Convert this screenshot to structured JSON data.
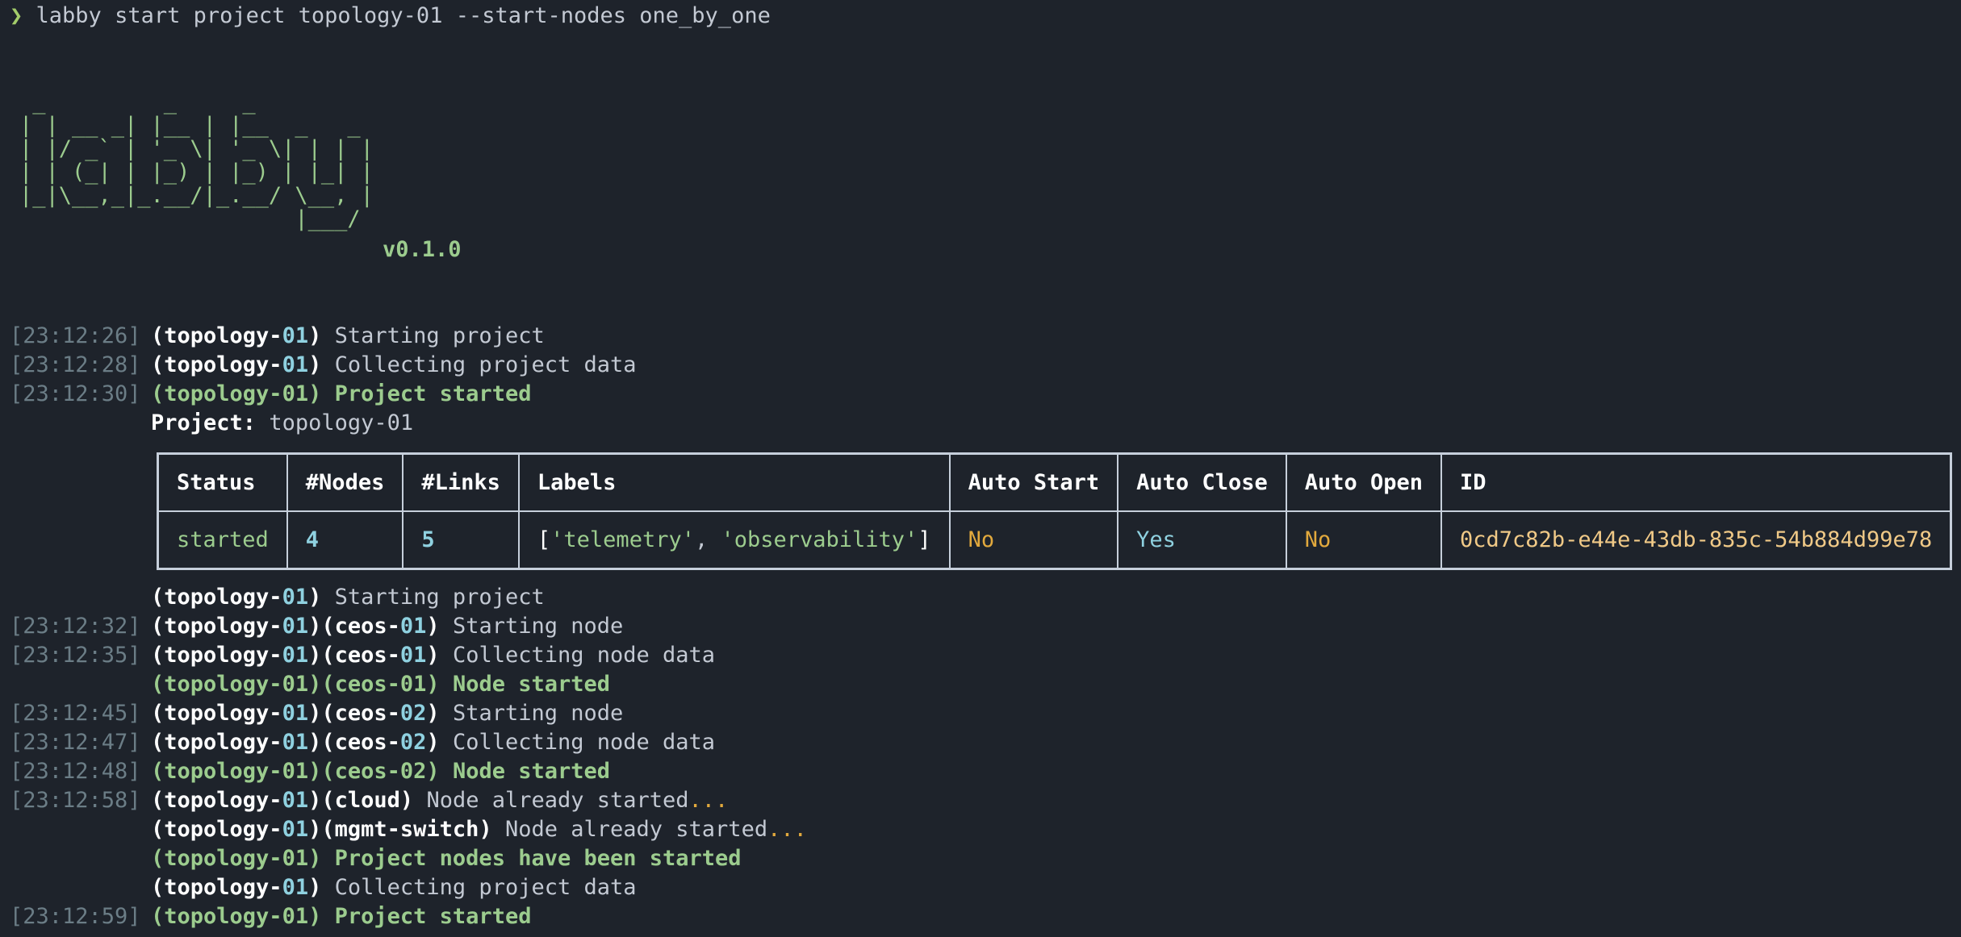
{
  "command": {
    "prompt_symbol": "❯",
    "text": "labby start project topology-01 --start-nodes one_by_one"
  },
  "banner": {
    "ascii": " _         _     _\n| | __ _| |__ | |__  _   _\n| |/ _` | '_ \\| '_ \\| | | |\n| | (_| | |_) | |_) | |_| |\n|_|\\__,_|_.__/|_.__/ \\__, |\n                     |___/",
    "version": "v0.1.0"
  },
  "log_top": [
    {
      "ts": "[23:12:26]",
      "project": "topology-",
      "project_num": "01",
      "msg": "Starting project",
      "success": false
    },
    {
      "ts": "[23:12:28]",
      "project": "topology-",
      "project_num": "01",
      "msg": "Collecting project data",
      "success": false
    },
    {
      "ts": "[23:12:30]",
      "project": "topology-",
      "project_num": "01",
      "msg": "Project started",
      "success": true
    }
  ],
  "project_label": "Project:",
  "project_name": "topology-01",
  "table": {
    "headers": [
      "Status",
      "#Nodes",
      "#Links",
      "Labels",
      "Auto Start",
      "Auto Close",
      "Auto Open",
      "ID"
    ],
    "row": {
      "status": "started",
      "nodes": "4",
      "links": "5",
      "label_open": "[",
      "label_1": "'telemetry'",
      "label_sep": ", ",
      "label_2": "'observability'",
      "label_close": "]",
      "auto_start": "No",
      "auto_close": "Yes",
      "auto_open": "No",
      "id": "0cd7c82b-e44e-43db-835c-54b884d99e78"
    }
  },
  "log_bottom": [
    {
      "ts": "",
      "project": "topology-",
      "project_num": "01",
      "node": "",
      "node_num": "",
      "msg": "Starting project",
      "success": false,
      "dots": ""
    },
    {
      "ts": "[23:12:32]",
      "project": "topology-",
      "project_num": "01",
      "node": "ceos-",
      "node_num": "01",
      "msg": "Starting node",
      "success": false,
      "dots": ""
    },
    {
      "ts": "[23:12:35]",
      "project": "topology-",
      "project_num": "01",
      "node": "ceos-",
      "node_num": "01",
      "msg": "Collecting node data",
      "success": false,
      "dots": ""
    },
    {
      "ts": "",
      "project": "topology-",
      "project_num": "01",
      "node": "ceos-",
      "node_num": "01",
      "msg": "Node started",
      "success": true,
      "dots": ""
    },
    {
      "ts": "[23:12:45]",
      "project": "topology-",
      "project_num": "01",
      "node": "ceos-",
      "node_num": "02",
      "msg": "Starting node",
      "success": false,
      "dots": ""
    },
    {
      "ts": "[23:12:47]",
      "project": "topology-",
      "project_num": "01",
      "node": "ceos-",
      "node_num": "02",
      "msg": "Collecting node data",
      "success": false,
      "dots": ""
    },
    {
      "ts": "[23:12:48]",
      "project": "topology-",
      "project_num": "01",
      "node": "ceos-",
      "node_num": "02",
      "msg": "Node started",
      "success": true,
      "dots": ""
    },
    {
      "ts": "[23:12:58]",
      "project": "topology-",
      "project_num": "01",
      "node": "cloud",
      "node_num": "",
      "msg": "Node already started",
      "success": false,
      "dots": "..."
    },
    {
      "ts": "",
      "project": "topology-",
      "project_num": "01",
      "node": "mgmt-switch",
      "node_num": "",
      "msg": "Node already started",
      "success": false,
      "dots": "..."
    },
    {
      "ts": "",
      "project": "topology-",
      "project_num": "01",
      "node": "",
      "node_num": "",
      "msg": "Project nodes have been started",
      "success": true,
      "dots": ""
    },
    {
      "ts": "",
      "project": "topology-",
      "project_num": "01",
      "node": "",
      "node_num": "",
      "msg": "Collecting project data",
      "success": false,
      "dots": ""
    },
    {
      "ts": "[23:12:59]",
      "project": "topology-",
      "project_num": "01",
      "node": "",
      "node_num": "",
      "msg": "Project started",
      "success": true,
      "dots": ""
    }
  ],
  "colors": {
    "background": "#1e232b",
    "prompt": "#a3cc6a",
    "success": "#9ccc8e",
    "accent_cyan": "#8fd1e0",
    "accent_yellow": "#e2a93d",
    "timestamp": "#6b7d86"
  }
}
